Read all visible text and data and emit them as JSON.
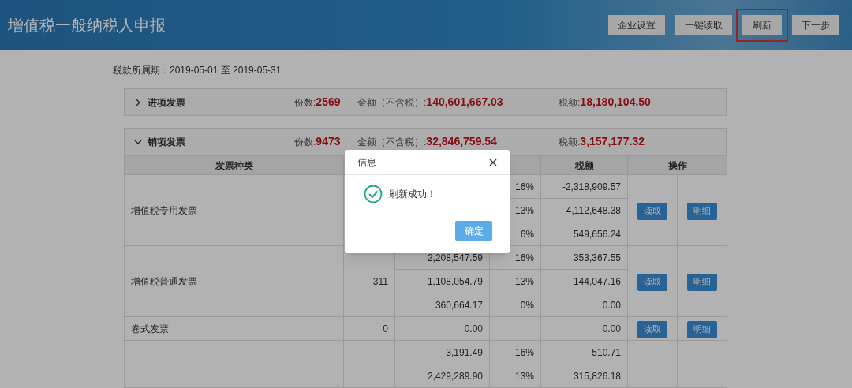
{
  "header": {
    "title": "增值税一般纳税人申报",
    "buttons": [
      {
        "label": "企业设置",
        "highlighted": false
      },
      {
        "label": "一键读取",
        "highlighted": false
      },
      {
        "label": "刷新",
        "highlighted": true
      },
      {
        "label": "下一步",
        "highlighted": false
      }
    ]
  },
  "period": "税款所属期：2019-05-01 至 2019-05-31",
  "sections": [
    {
      "title": "进项发票",
      "expanded": false,
      "count_label": "份数:",
      "count": "2569",
      "amount_label": "金额（不含税）:",
      "amount": "140,601,667.03",
      "tax_label": "税额:",
      "tax": "18,180,104.50"
    },
    {
      "title": "销项发票",
      "expanded": true,
      "count_label": "份数:",
      "count": "9473",
      "amount_label": "金额（不含税）:",
      "amount": "32,846,759.54",
      "tax_label": "税额:",
      "tax": "3,157,177.32"
    }
  ],
  "table": {
    "columns": [
      {
        "label": "发票种类"
      },
      {},
      {},
      {},
      {
        "label": "税额"
      },
      {
        "label": "操作"
      }
    ],
    "groups": [
      {
        "type": "增值税专用发票",
        "lines": [
          {
            "rate": "16%",
            "tax": "-2,318,909.57"
          },
          {
            "rate": "13%",
            "tax": "4,112,648.38"
          },
          {
            "rate": "6%",
            "tax": "549,656.24"
          }
        ],
        "actions": [
          "读取",
          "明细"
        ]
      },
      {
        "type": "增值税普通发票",
        "count": "311",
        "lines": [
          {
            "amount": "2,208,547.59",
            "rate": "16%",
            "tax": "353,367.55"
          },
          {
            "amount": "1,108,054.79",
            "rate": "13%",
            "tax": "144,047.16"
          },
          {
            "amount": "360,664.17",
            "rate": "0%",
            "tax": "0.00"
          }
        ],
        "actions": [
          "读取",
          "明细"
        ]
      },
      {
        "type": "卷式发票",
        "count": "0",
        "lines": [
          {
            "amount": "0.00",
            "tax": "0.00"
          }
        ],
        "actions": [
          "读取",
          "明细"
        ]
      },
      {
        "lines": [
          {
            "amount": "3,191.49",
            "rate": "16%",
            "tax": "510.71"
          },
          {
            "amount": "2,429,289.90",
            "rate": "13%",
            "tax": "315,826.18"
          }
        ]
      }
    ]
  },
  "dialog": {
    "title": "信息",
    "message": "刷新成功！",
    "ok": "确定"
  }
}
